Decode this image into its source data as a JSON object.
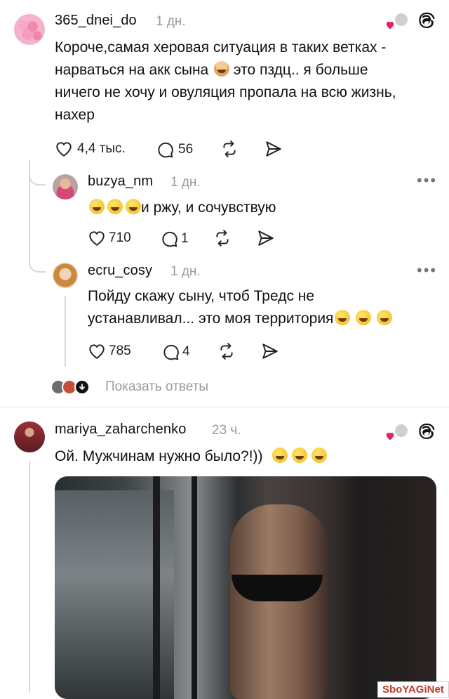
{
  "post1": {
    "username": "365_dnei_do",
    "time": "1 дн.",
    "text_lines": [
      "Короче,самая херовая ситуация в таких ветках -",
      "нарваться на акк сына",
      "это пздц.. я больше",
      "ничего не хочу и овуляция пропала на всю жизнь,",
      "нахер"
    ],
    "likes": "4,4 тыс.",
    "comments": "56"
  },
  "reply1": {
    "username": "buzya_nm",
    "time": "1 дн.",
    "text": "и ржу, и сочувствую",
    "likes": "710",
    "comments": "1"
  },
  "reply2": {
    "username": "ecru_cosy",
    "time": "1 дн.",
    "text_lines": [
      "Пойду скажу сыну, чтоб Тредс не",
      "устанавливал... это моя территория"
    ],
    "likes": "785",
    "comments": "4"
  },
  "show_replies": "Показать ответы",
  "post2": {
    "username": "mariya_zaharchenko",
    "time": "23 ч.",
    "text": "Ой. Мужчинам нужно было?!))"
  },
  "watermark": "SboYAGiNet",
  "colors": {
    "heart": "#e0245e",
    "muted": "#9a9a9a",
    "line": "#d8d8d8"
  },
  "icons": [
    "heart-icon",
    "comment-icon",
    "repost-icon",
    "share-icon",
    "threads-icon",
    "more-icon",
    "chevron-down-icon"
  ]
}
